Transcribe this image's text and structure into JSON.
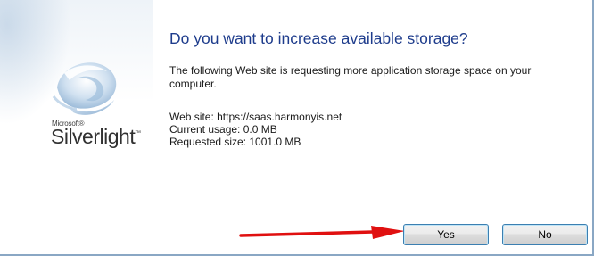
{
  "brand": {
    "microsoft": "Microsoft®",
    "product": "Silverlight",
    "tm": "™"
  },
  "dialog": {
    "title": "Do you want to increase available storage?",
    "description": "The following Web site is requesting more application storage space on your computer.",
    "info": {
      "website": "Web site: https://saas.harmonyis.net",
      "current_usage": "Current usage: 0.0 MB",
      "requested_size": "Requested size: 1001.0 MB"
    },
    "buttons": {
      "yes": "Yes",
      "no": "No"
    }
  },
  "colors": {
    "title": "#1e3c8c",
    "annotation_arrow": "#e01010"
  }
}
